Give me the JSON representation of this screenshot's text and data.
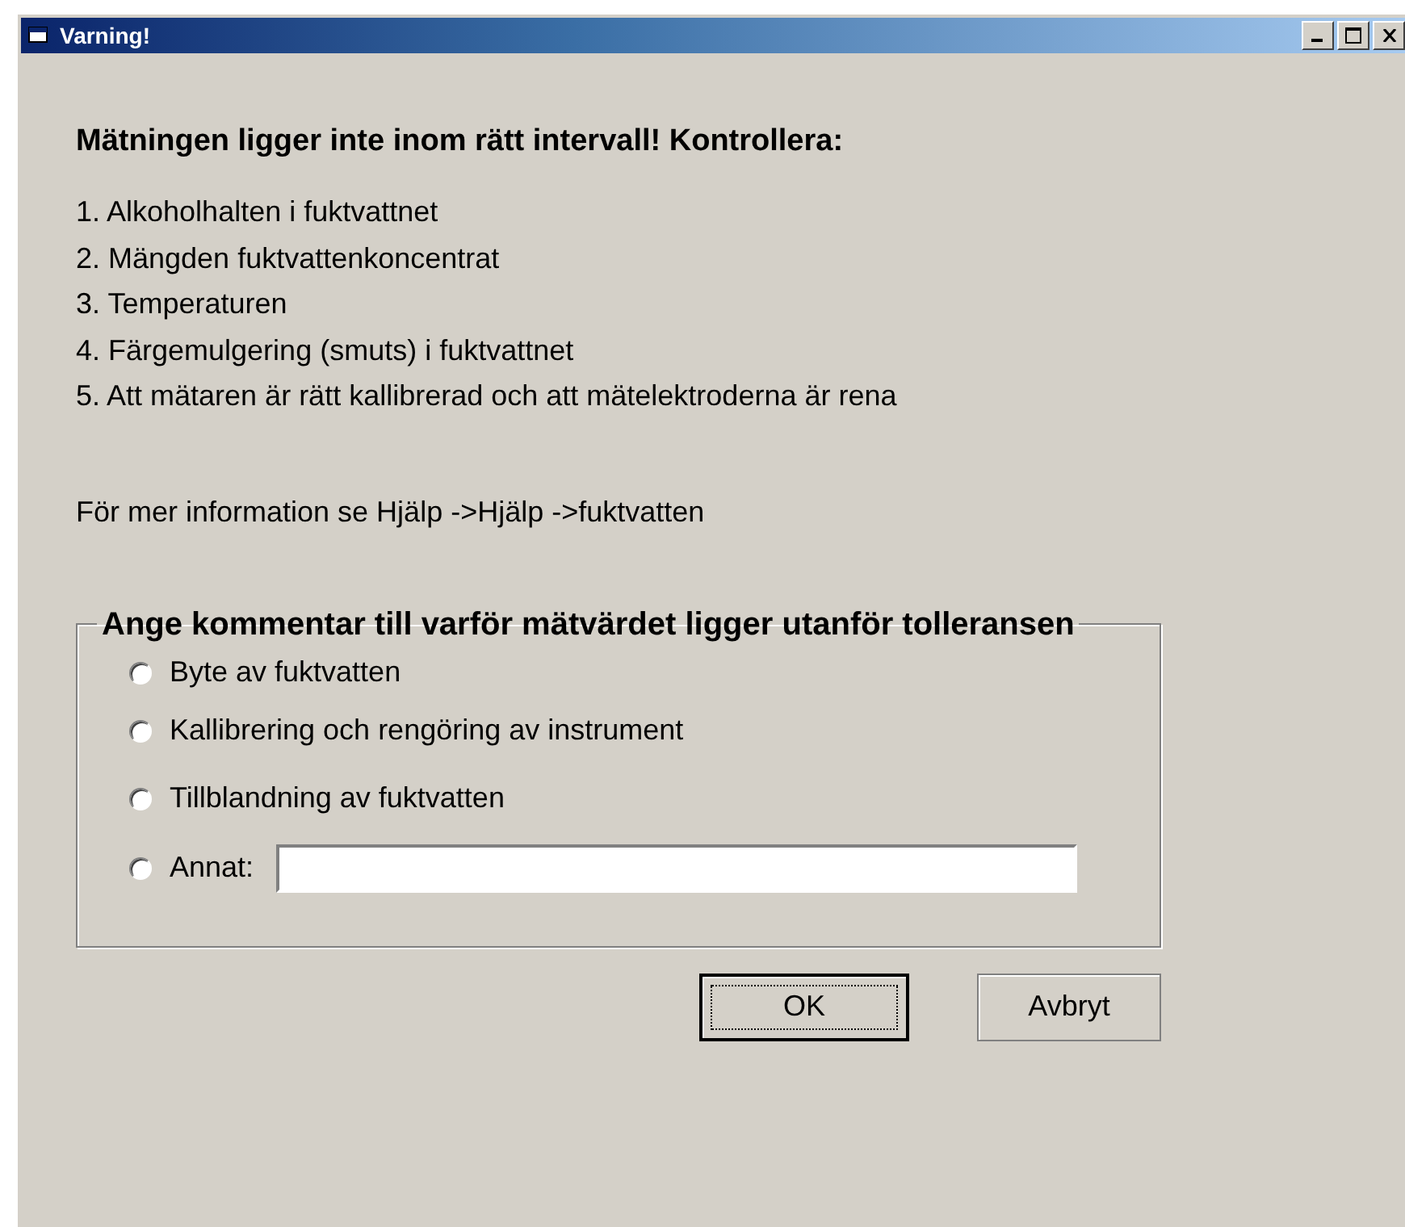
{
  "window": {
    "title": "Varning!"
  },
  "heading": "Mätningen ligger inte inom rätt intervall! Kontrollera:",
  "checklist": [
    "1. Alkoholhalten i fuktvattnet",
    "2. Mängden fuktvattenkoncentrat",
    "3. Temperaturen",
    "4. Färgemulgering (smuts) i fuktvattnet",
    "5. Att mätaren är rätt kallibrerad och att mätelektroderna är rena"
  ],
  "info": "För mer information se Hjälp ->Hjälp ->fuktvatten",
  "comment_group": {
    "legend": "Ange kommentar till varför mätvärdet ligger utanför tolleransen",
    "options": [
      {
        "label": "Byte av fuktvatten",
        "selected": false,
        "kind": "plain"
      },
      {
        "label": "Kallibrering och rengöring av instrument",
        "selected": false,
        "kind": "plain"
      },
      {
        "label": "Tillblandning av fuktvatten",
        "selected": false,
        "kind": "plain"
      },
      {
        "label": "Annat:",
        "selected": false,
        "kind": "other"
      }
    ]
  },
  "buttons": [
    {
      "label": "OK",
      "focused": true
    },
    {
      "label": "Avbryt",
      "focused": false
    }
  ]
}
